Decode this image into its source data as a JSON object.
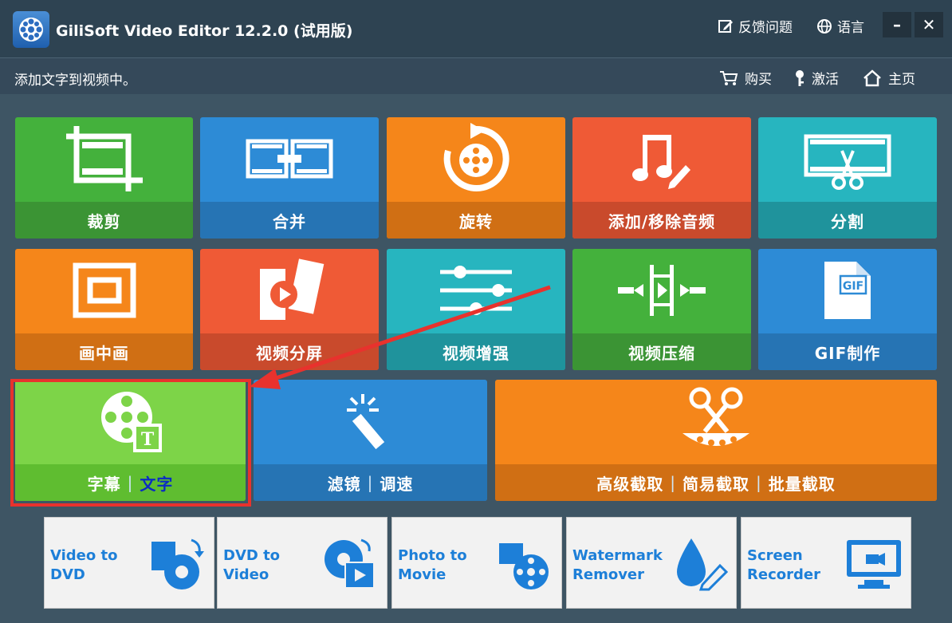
{
  "app": {
    "title": "GiliSoft Video Editor 12.2.0 (试用版)",
    "feedback": "反馈问题",
    "language": "语言",
    "minimize": "–",
    "close": "✕"
  },
  "subbar": {
    "status": "添加文字到视频中。",
    "buy": "购买",
    "activate": "激活",
    "home": "主页"
  },
  "tiles": {
    "crop": "裁剪",
    "merge": "合并",
    "rotate": "旋转",
    "audio": "添加/移除音频",
    "split": "分割",
    "pip": "画中画",
    "splitscreen": "视频分屏",
    "enhance": "视频增强",
    "compress": "视频压缩",
    "gif": "GIF制作",
    "subtitle": "字幕",
    "text": "文字",
    "filter": "滤镜",
    "speed": "调速",
    "cut_advanced": "高级截取",
    "cut_simple": "简易截取",
    "cut_batch": "批量截取"
  },
  "bottom": {
    "dvd": "Video to\nDVD",
    "dvd2video": "DVD to\nVideo",
    "photo": "Photo to\nMovie",
    "watermark": "Watermark\nRemover",
    "recorder": "Screen\nRecorder"
  },
  "colors": {
    "highlight": "#e8322d",
    "bottom_text": "#1d7fd8"
  }
}
